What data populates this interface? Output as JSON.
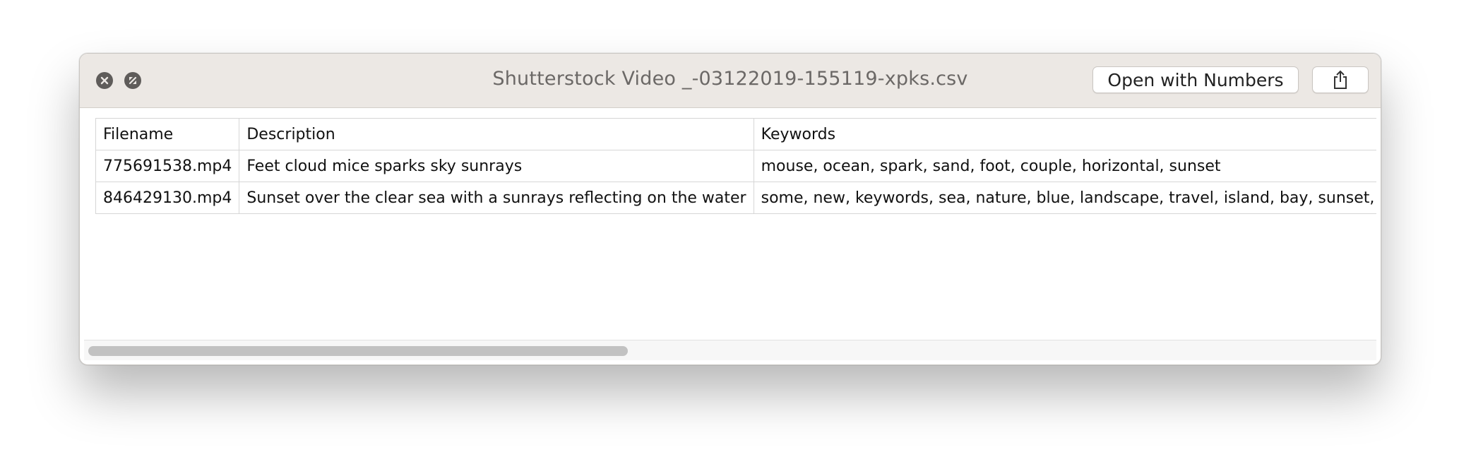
{
  "window": {
    "title": "Shutterstock Video _-03122019-155119-xpks.csv",
    "buttons": {
      "close_icon": "close-icon",
      "fullscreen_icon": "fullscreen-icon",
      "open_with_label": "Open with Numbers",
      "share_icon": "share-icon"
    }
  },
  "table": {
    "headers": [
      "Filename",
      "Description",
      "Keywords"
    ],
    "rows": [
      [
        "775691538.mp4",
        "Feet cloud mice sparks sky sunrays",
        "mouse, ocean, spark, sand, foot, couple, horizontal, sunset"
      ],
      [
        "846429130.mp4",
        "Sunset over the clear sea with a sunrays reflecting on the water",
        "some, new, keywords, sea, nature, blue, landscape, travel, island, bay, sunset, ocean, sun, sky"
      ]
    ]
  },
  "scrollbar": {
    "horizontal_visible_fraction": 0.42
  }
}
